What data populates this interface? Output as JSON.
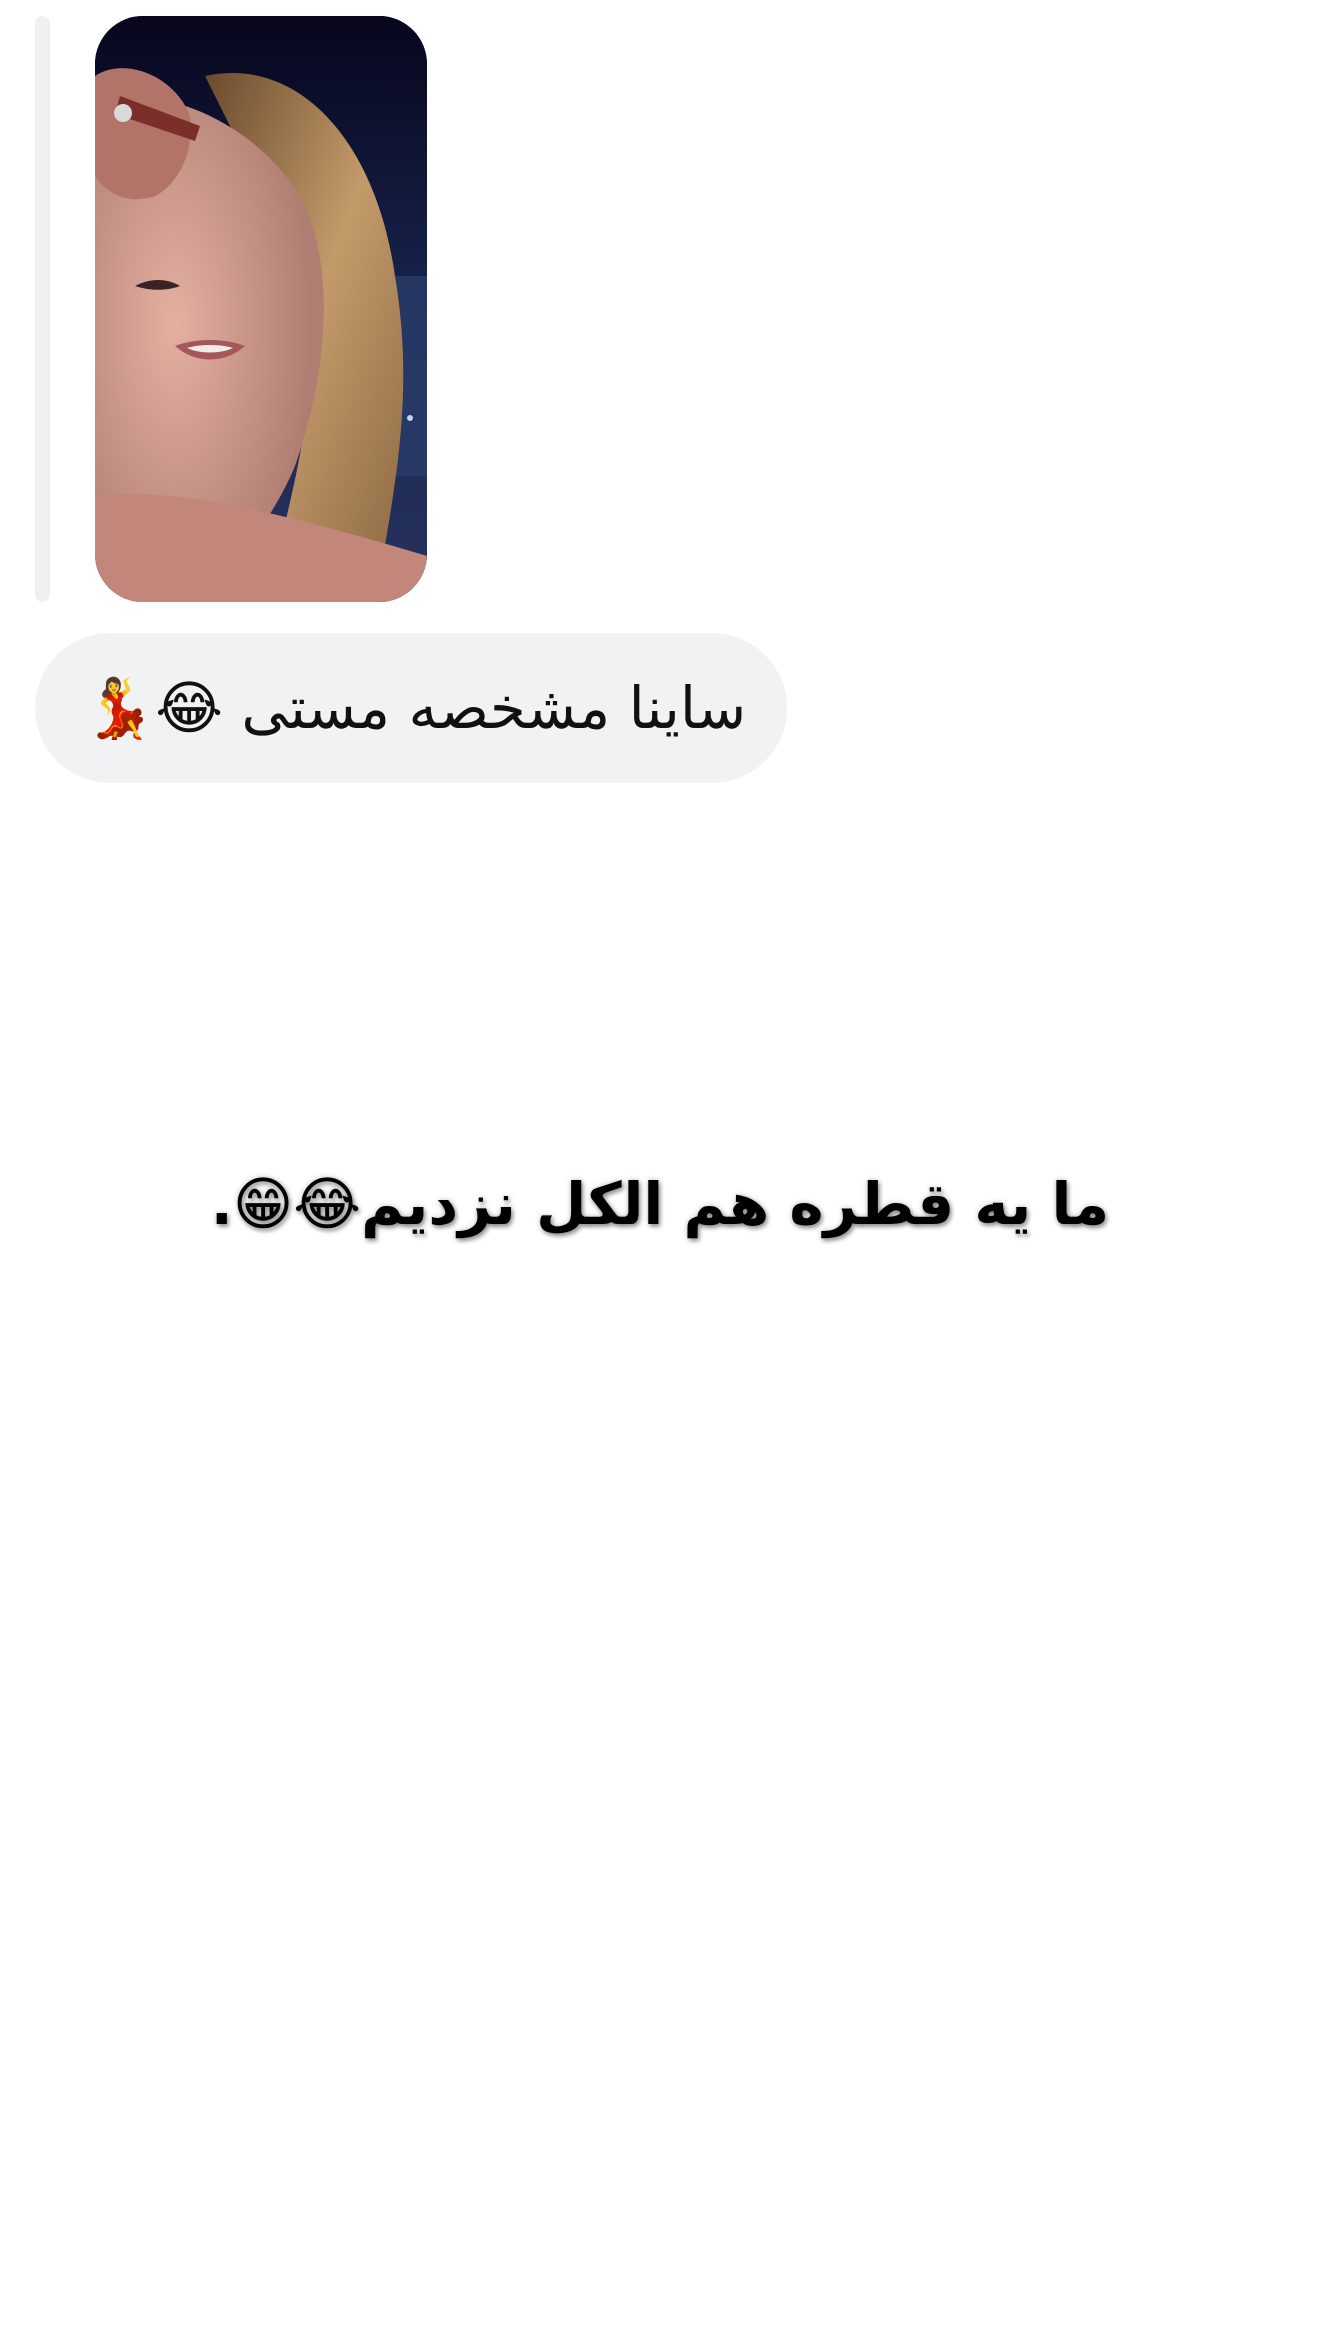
{
  "reply": {
    "media_icon": "video-thumbnail",
    "message_text": "ساینا مشخصه مستی 😂💃"
  },
  "caption": {
    "text": "ما یه قطره هم الکل نزدیم😂😁."
  },
  "colors": {
    "background": "#ffffff",
    "bubble": "#f0f2f4",
    "reply_bar": "#eef0f2",
    "text": "#111111"
  }
}
